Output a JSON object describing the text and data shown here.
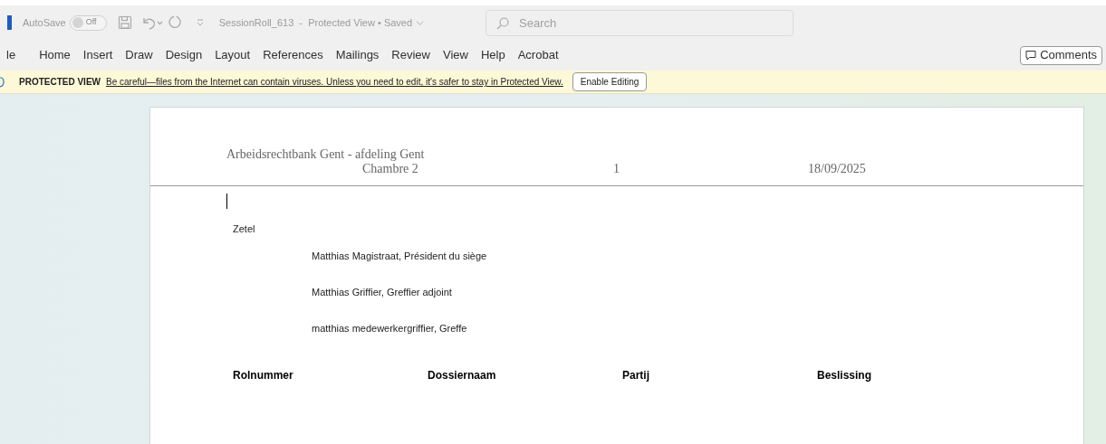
{
  "title_bar": {
    "autosave": {
      "label": "AutoSave",
      "on": false,
      "state_text": "Off"
    },
    "document_title": "SessionRoll_613  -  Protected View • Saved",
    "search": {
      "placeholder": "Search"
    }
  },
  "ribbon": {
    "tabs": [
      "le",
      "Home",
      "Insert",
      "Draw",
      "Design",
      "Layout",
      "References",
      "Mailings",
      "Review",
      "View",
      "Help",
      "Acrobat"
    ],
    "comments_button": "Comments"
  },
  "protected_view": {
    "label": "PROTECTED VIEW",
    "message": "Be careful—files from the Internet can contain viruses. Unless you need to edit, it's safer to stay in Protected View.",
    "button": "Enable Editing"
  },
  "document": {
    "header": {
      "court": "Arbeidsrechtbank Gent - afdeling Gent",
      "chamber": "Chambre 2",
      "page_number": "1",
      "date": "18/09/2025"
    },
    "zetel_label": "Zetel",
    "members": [
      "Matthias Magistraat, Président du siège",
      "Matthias Griffier, Greffier adjoint",
      "matthias medewerkergriffier, Greffe"
    ],
    "table": {
      "columns": [
        "Rolnummer",
        "Dossiernaam",
        "Partij",
        "Beslissing"
      ]
    }
  }
}
